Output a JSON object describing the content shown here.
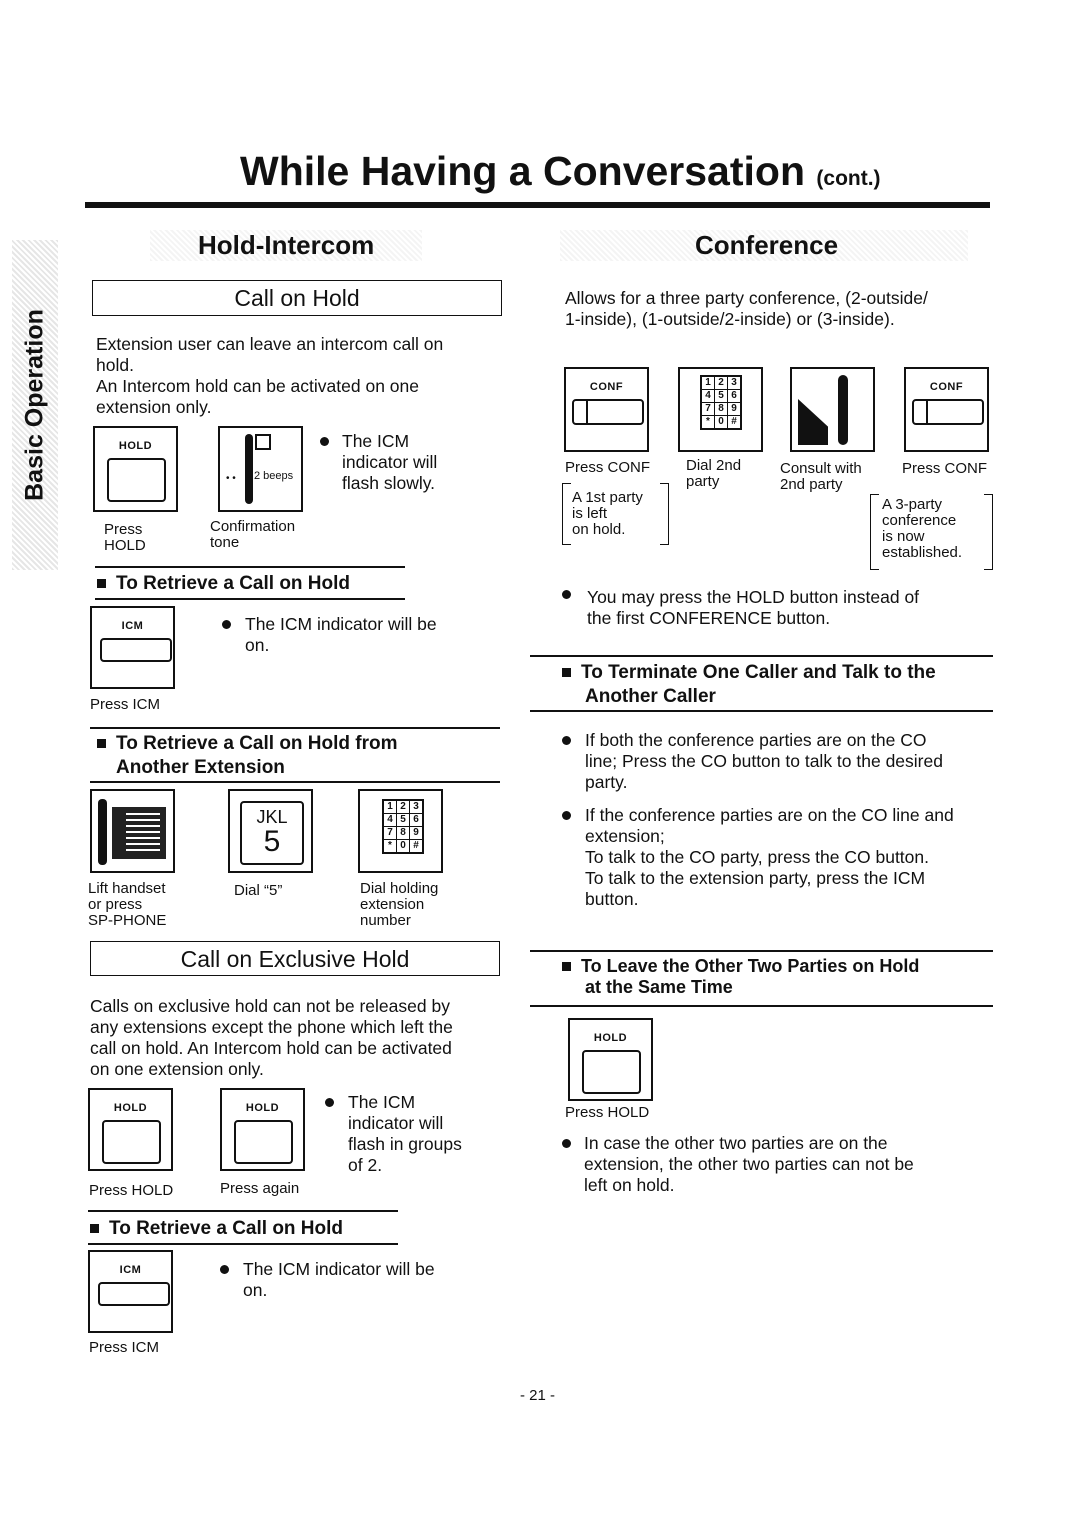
{
  "title": {
    "main": "While Having a Conversation",
    "suffix": "(cont.)"
  },
  "side_tab": "Basic Operation",
  "left": {
    "heading": "Hold-Intercom",
    "call_on_hold": {
      "title": "Call on Hold",
      "para": [
        "Extension user can leave an intercom call on",
        "hold.",
        "An Intercom hold can be activated on one",
        "extension only."
      ],
      "hold_key": "HOLD",
      "beeps": "2 beeps",
      "bullet": [
        "The ICM",
        "indicator will",
        "flash slowly."
      ],
      "label_press": [
        "Press",
        "HOLD"
      ],
      "label_conf": [
        "Confirmation",
        "tone"
      ]
    },
    "retrieve": {
      "title": "To Retrieve a Call on Hold",
      "key": "ICM",
      "bullet": [
        "The ICM indicator will be",
        "on."
      ],
      "label": "Press ICM"
    },
    "retrieve_other": {
      "title": [
        "To Retrieve a Call on Hold from",
        "Another Extension"
      ],
      "jkl": "JKL",
      "five": "5",
      "keypad": [
        "1",
        "2",
        "3",
        "4",
        "5",
        "6",
        "7",
        "8",
        "9",
        "*",
        "0",
        "#"
      ],
      "labels": [
        [
          "Lift handset",
          "or press",
          "SP-PHONE"
        ],
        [
          "Dial “5”"
        ],
        [
          "Dial holding",
          "extension",
          "number"
        ]
      ]
    },
    "exclusive": {
      "title": "Call on Exclusive Hold",
      "para": [
        "Calls on exclusive hold can not be released by",
        "any extensions except the phone which left the",
        "call on hold. An Intercom hold can be activated",
        "on one extension only."
      ],
      "key": "HOLD",
      "bullet": [
        "The ICM",
        "indicator will",
        "flash in groups",
        "of 2."
      ],
      "labels": [
        "Press HOLD",
        "Press again"
      ]
    },
    "retrieve2": {
      "title": "To Retrieve a Call on Hold",
      "key": "ICM",
      "bullet": [
        "The ICM indicator will be",
        "on."
      ],
      "label": "Press ICM"
    }
  },
  "right": {
    "heading": "Conference",
    "para": [
      "Allows for a three party conference, (2-outside/",
      "1-inside), (1-outside/2-inside) or (3-inside)."
    ],
    "conf_key": "CONF",
    "labels": [
      [
        "Press CONF"
      ],
      [
        "Dial 2nd",
        "party"
      ],
      [
        "Consult with",
        "2nd party"
      ],
      [
        "Press CONF"
      ]
    ],
    "note1": [
      "A 1st party",
      "is left",
      "on hold."
    ],
    "note2": [
      "A 3-party",
      "conference",
      "is now",
      "established."
    ],
    "bullet": [
      "You may press the HOLD button instead of",
      "the first CONFERENCE button."
    ],
    "terminate": {
      "title": [
        "To Terminate One Caller and Talk to the",
        "Another Caller"
      ],
      "b1": [
        "If both the conference parties are on the CO",
        "line; Press the CO button to talk to the desired",
        "party."
      ],
      "b2": [
        "If the conference parties are on the CO line and",
        "extension;",
        "To talk to the CO party, press the CO button.",
        "To talk to the extension party, press the ICM",
        "button."
      ]
    },
    "leave": {
      "title": [
        "To Leave the Other Two Parties on Hold",
        "at the Same Time"
      ],
      "key": "HOLD",
      "label": "Press HOLD",
      "bullet": [
        "In case the other two parties are on the",
        "extension, the other two parties can not be",
        "left on hold."
      ]
    }
  },
  "page_number": "- 21 -"
}
